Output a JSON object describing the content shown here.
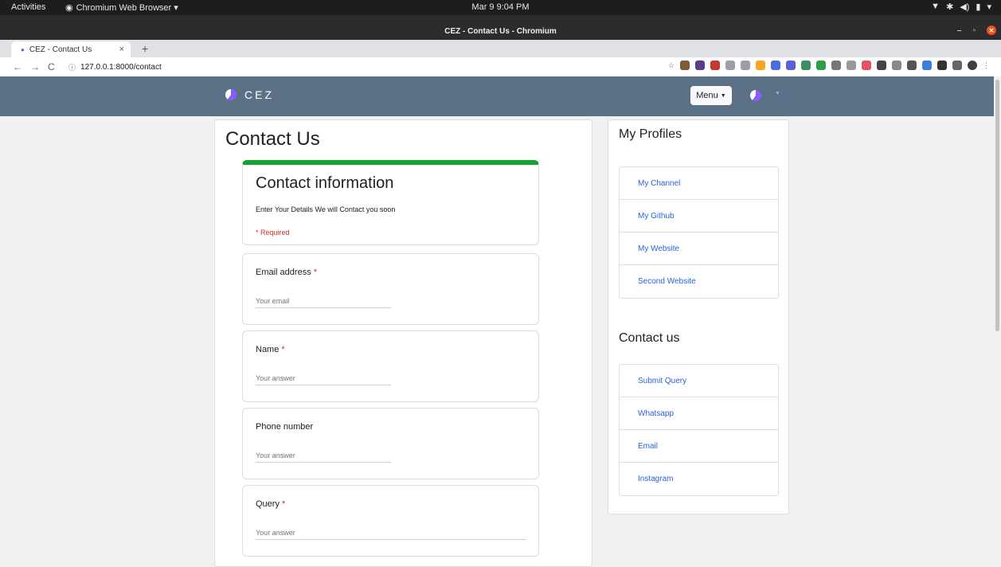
{
  "system_bar": {
    "activities": "Activities",
    "app_name": "Chromium Web Browser ▾",
    "clock": "Mar 9  9:04 PM"
  },
  "window": {
    "title": "CEZ - Contact Us - Chromium"
  },
  "browser": {
    "tab_title": "CEZ - Contact Us",
    "url": "127.0.0.1:8000/contact"
  },
  "site": {
    "brand": "CEZ",
    "menu_label": "Menu"
  },
  "main": {
    "page_title": "Contact Us",
    "info": {
      "title": "Contact information",
      "description": "Enter Your Details We will Contact you soon",
      "required_note": "* Required"
    },
    "questions": [
      {
        "label": "Email address",
        "required": "*",
        "placeholder": "Your email"
      },
      {
        "label": "Name",
        "required": "*",
        "placeholder": "Your answer"
      },
      {
        "label": "Phone number",
        "required": "",
        "placeholder": "Your answer"
      },
      {
        "label": "Query",
        "required": "*",
        "placeholder": "Your answer"
      }
    ]
  },
  "sidebar": {
    "profiles_title": "My Profiles",
    "profiles": [
      "My Channel",
      "My Github",
      "My Website",
      "Second Website"
    ],
    "contact_title": "Contact us",
    "contacts": [
      "Submit Query",
      "Whatsapp",
      "Email",
      "Instagram"
    ]
  },
  "colors": {
    "navbar": "#5b7186",
    "accent_green": "#13a42f",
    "required_red": "#d93025",
    "link_blue": "#2a62d8"
  }
}
